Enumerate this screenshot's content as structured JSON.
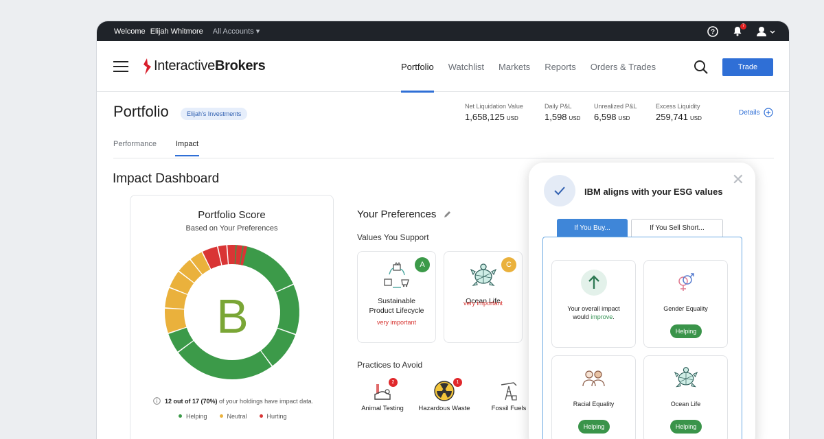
{
  "topbar": {
    "welcome": "Welcome",
    "user": "Elijah Whitmore",
    "accounts": "All Accounts",
    "notification_count": "7"
  },
  "nav": {
    "brand_prefix": "Interactive",
    "brand_suffix": "Brokers",
    "links": [
      "Portfolio",
      "Watchlist",
      "Markets",
      "Reports",
      "Orders & Trades"
    ],
    "active": "Portfolio",
    "trade": "Trade"
  },
  "portfolio": {
    "title": "Portfolio",
    "account_pill": "Elijah's Investments",
    "stats": [
      {
        "label": "Net Liquidation Value",
        "value": "1,658,125",
        "unit": "USD"
      },
      {
        "label": "Daily P&L",
        "value": "1,598",
        "unit": "USD"
      },
      {
        "label": "Unrealized P&L",
        "value": "6,598",
        "unit": "USD"
      },
      {
        "label": "Excess Liquidity",
        "value": "259,741",
        "unit": "USD"
      }
    ],
    "details": "Details"
  },
  "subtabs": [
    "Performance",
    "Impact"
  ],
  "dashboard": {
    "title": "Impact Dashboard",
    "score_title": "Portfolio Score",
    "score_subtitle": "Based on Your Preferences",
    "grade": "B",
    "note_bold": "12 out of 17 (70%)",
    "note_rest": "of your holdings have impact data.",
    "legend": [
      "Helping",
      "Neutral",
      "Hurting"
    ],
    "colors": {
      "helping": "#3c9a49",
      "neutral": "#eab13c",
      "hurting": "#d93535"
    }
  },
  "preferences": {
    "title": "Your Preferences",
    "values_label": "Values You Support",
    "values": [
      {
        "name_line1": "Sustainable",
        "name_line2": "Product Lifecycle",
        "importance": "very important",
        "grade": "A",
        "grade_color": "#3c9a49",
        "icon": "recycle-icon"
      },
      {
        "name_line1": "Ocean Life",
        "name_line2": "",
        "importance": "very important",
        "grade": "C",
        "grade_color": "#eab13c",
        "icon": "turtle-icon"
      }
    ],
    "avoid_label": "Practices to Avoid",
    "avoid": [
      {
        "name": "Animal Testing",
        "count": "2",
        "icon": "lab-icon"
      },
      {
        "name": "Hazardous Waste",
        "count": "1",
        "icon": "radiation-icon"
      },
      {
        "name": "Fossil Fuels",
        "count": "",
        "icon": "oil-pump-icon"
      }
    ]
  },
  "popover": {
    "title": "IBM aligns with your ESG values",
    "tabs": [
      "If You Buy...",
      "If You Sell Short..."
    ],
    "cards": [
      {
        "label_a": "Your overall impact would ",
        "label_b": "improve",
        "label_c": ".",
        "badge": "",
        "icon": "arrow-up-icon"
      },
      {
        "label_a": "Gender Equality",
        "label_b": "",
        "label_c": "",
        "badge": "Helping",
        "icon": "gender-icon"
      },
      {
        "label_a": "Racial Equality",
        "label_b": "",
        "label_c": "",
        "badge": "Helping",
        "icon": "people-icon"
      },
      {
        "label_a": "Ocean Life",
        "label_b": "",
        "label_c": "",
        "badge": "Helping",
        "icon": "turtle-icon"
      }
    ]
  }
}
